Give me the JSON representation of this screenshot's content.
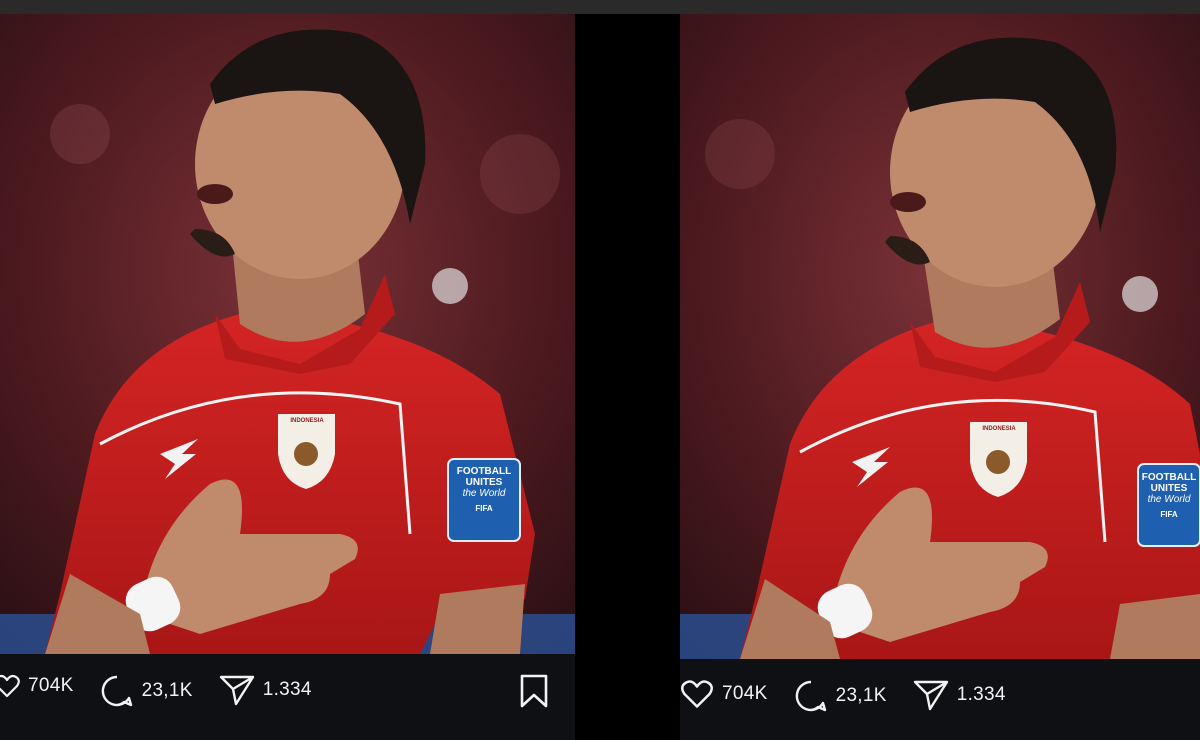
{
  "colors": {
    "background": "#000000",
    "action_bar": "#0f1013",
    "jersey_red": "#c81e1e",
    "stadium_blur": "#5a2024",
    "badge_blue": "#1f5fb0",
    "icon_text": "#f2f2f2"
  },
  "posts": [
    {
      "likes": "704K",
      "comments": "23,1K",
      "shares": "1.334",
      "icons": [
        "heart-icon",
        "comment-icon",
        "share-icon",
        "bookmark-icon"
      ],
      "sleeve_badge": [
        "FOOTBALL",
        "UNITES",
        "the World",
        "FIFA"
      ],
      "crest_text": "INDONESIA"
    },
    {
      "likes": "704K",
      "comments": "23,1K",
      "shares": "1.334",
      "icons": [
        "heart-icon",
        "comment-icon",
        "share-icon"
      ],
      "sleeve_badge": [
        "FOOTBALL",
        "UNITES",
        "the World",
        "FIFA"
      ],
      "crest_text": "INDONESIA"
    }
  ]
}
